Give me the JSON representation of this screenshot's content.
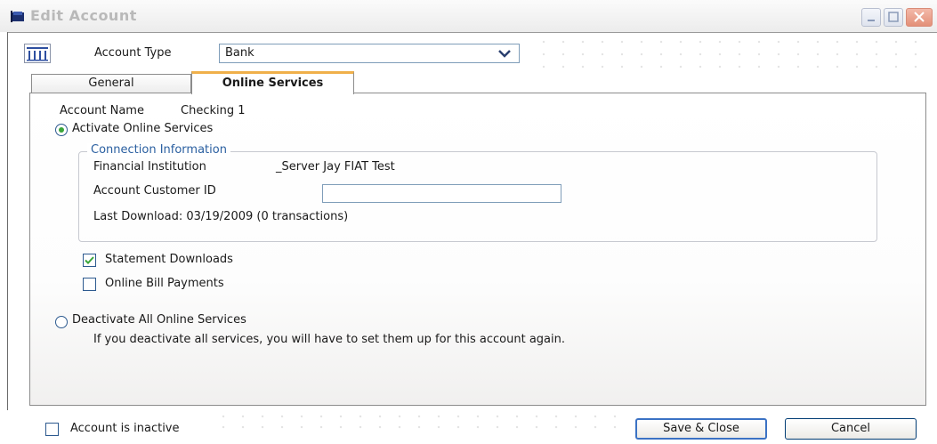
{
  "window": {
    "title": "Edit Account"
  },
  "account_type": {
    "label": "Account Type",
    "value": "Bank"
  },
  "tabs": [
    {
      "label": "General",
      "active": false
    },
    {
      "label": "Online Services",
      "active": true
    }
  ],
  "online_services": {
    "account_name_label": "Account Name",
    "account_name_value": "Checking 1",
    "activate_label": "Activate Online Services",
    "activate_selected": true,
    "connection": {
      "legend": "Connection Information",
      "institution_label": "Financial Institution",
      "institution_value": "_Server Jay FIAT Test",
      "customer_id_label": "Account Customer ID",
      "customer_id_value": "",
      "last_download": "Last Download: 03/19/2009 (0 transactions)"
    },
    "statement_downloads_label": "Statement Downloads",
    "statement_downloads_checked": true,
    "bill_payments_label": "Online Bill Payments",
    "bill_payments_checked": false,
    "deactivate_label": "Deactivate All Online Services",
    "deactivate_selected": false,
    "deactivate_note": "If you deactivate all services, you will have to set them up for this account again."
  },
  "footer": {
    "inactive_label": "Account is inactive",
    "inactive_checked": false,
    "save_label": "Save & Close",
    "cancel_label": "Cancel"
  },
  "colors": {
    "tab_accent": "#f0b04a",
    "legend_text": "#2a5fa0",
    "check_green": "#3aa53a"
  }
}
